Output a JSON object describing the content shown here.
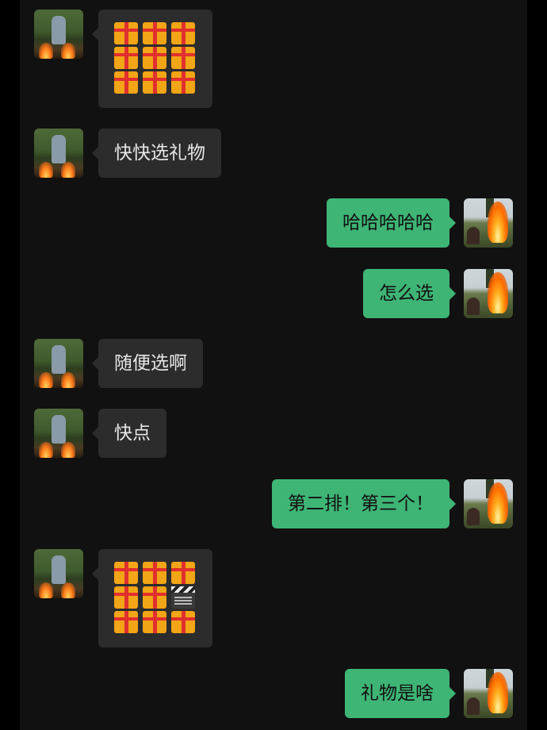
{
  "conversation": {
    "messages": [
      {
        "sender": "friend",
        "type": "sticker",
        "grid": [
          "gift",
          "gift",
          "gift",
          "gift",
          "gift",
          "gift",
          "gift",
          "gift",
          "gift"
        ]
      },
      {
        "sender": "friend",
        "type": "text",
        "text": "快快选礼物"
      },
      {
        "sender": "me",
        "type": "text",
        "text": "哈哈哈哈哈"
      },
      {
        "sender": "me",
        "type": "text",
        "text": "怎么选"
      },
      {
        "sender": "friend",
        "type": "text",
        "text": "随便选啊"
      },
      {
        "sender": "friend",
        "type": "text",
        "text": "快点"
      },
      {
        "sender": "me",
        "type": "text",
        "text": "第二排！第三个！"
      },
      {
        "sender": "friend",
        "type": "sticker",
        "grid": [
          "gift",
          "gift",
          "gift",
          "gift",
          "gift",
          "clapper-board",
          "gift",
          "gift",
          "gift"
        ]
      },
      {
        "sender": "me",
        "type": "text",
        "text": "礼物是啥"
      }
    ]
  },
  "colors": {
    "background": "#111111",
    "incoming_bubble": "#2c2c2c",
    "outgoing_bubble": "#3eb575"
  },
  "icons": {
    "gift": "wrapped-gift-icon",
    "clapper-board": "clapper-board-icon"
  }
}
